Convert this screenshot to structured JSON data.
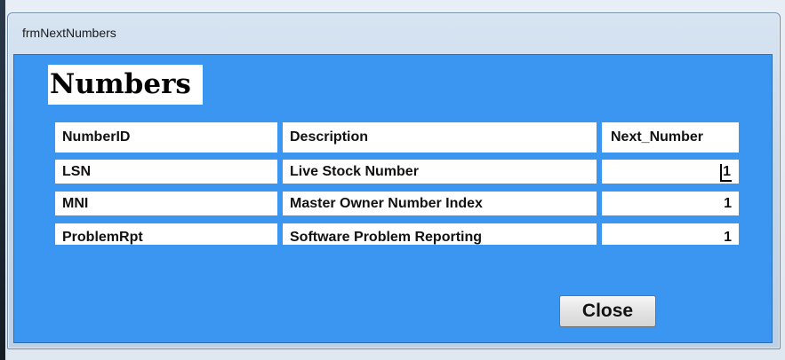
{
  "window": {
    "title": "frmNextNumbers"
  },
  "form": {
    "heading": "Numbers",
    "columns": [
      "NumberID",
      "Description",
      "Next_Number"
    ],
    "rows": [
      {
        "number_id": "LSN",
        "description": "Live Stock Number",
        "next_number": "1"
      },
      {
        "number_id": "MNI",
        "description": "Master Owner Number Index",
        "next_number": "1"
      },
      {
        "number_id": "ProblemRpt",
        "description": "Software Problem Reporting",
        "next_number": "1"
      }
    ],
    "close_label": "Close"
  },
  "colors": {
    "form_background": "#3a96f0",
    "cell_background": "#ffffff"
  }
}
